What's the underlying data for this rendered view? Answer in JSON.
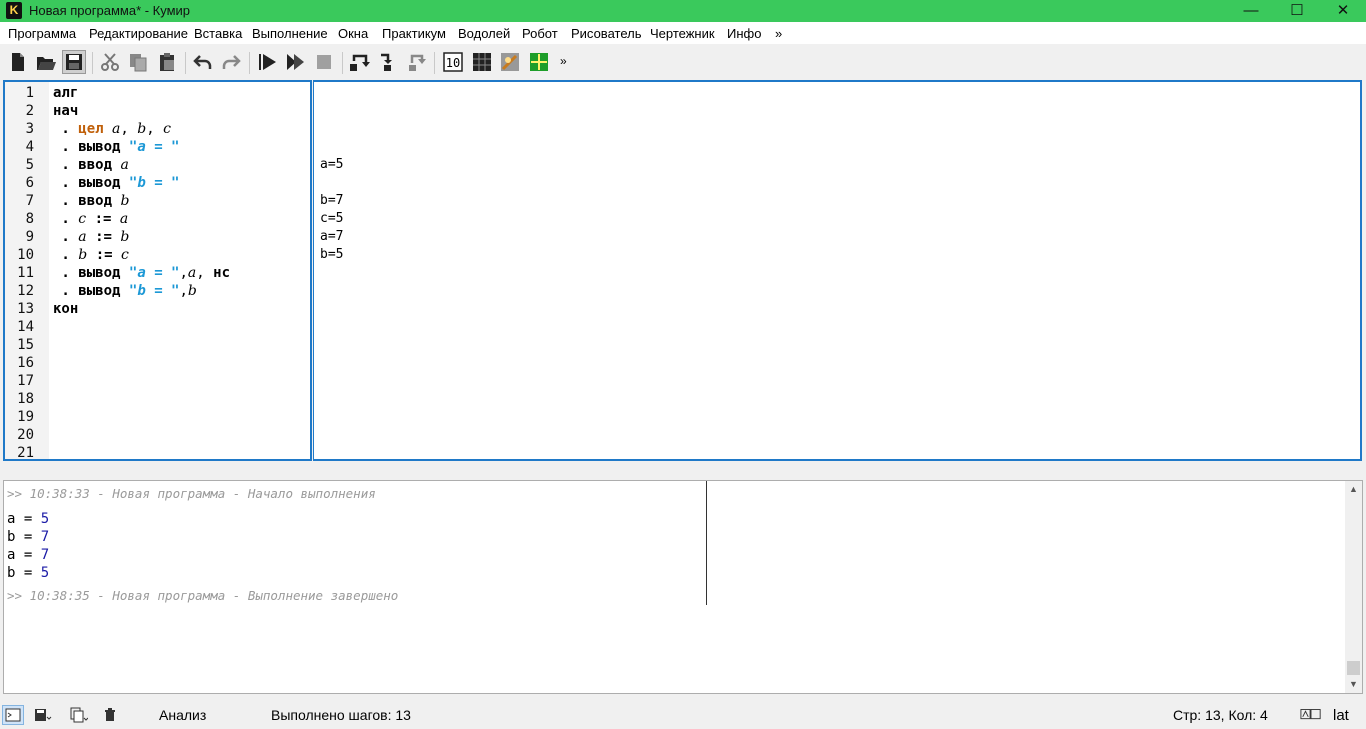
{
  "window": {
    "title": "Новая программа* - Кумир",
    "app_letter": "K",
    "minimize": "—",
    "maximize": "☐",
    "close": "✕"
  },
  "menu": [
    "Программа",
    "Редактирование",
    "Вставка",
    "Выполнение",
    "Окна",
    "Практикум",
    "Водолей",
    "Робот",
    "Рисователь",
    "Чертежник",
    "Инфо",
    "»"
  ],
  "toolbar": {
    "icons": [
      "new-file-icon",
      "open-folder-icon",
      "save-icon",
      "cut-icon",
      "copy-icon",
      "paste-icon",
      "undo-icon",
      "redo-icon",
      "run-icon",
      "run-step-icon",
      "stop-icon",
      "step-over-icon",
      "step-into-icon",
      "step-out-icon",
      "counter-icon",
      "grid-icon",
      "painter-icon",
      "drawer-icon"
    ],
    "overflow": "»"
  },
  "editor": {
    "line_numbers": [
      "1",
      "2",
      "3",
      "4",
      "5",
      "6",
      "7",
      "8",
      "9",
      "10",
      "11",
      "12",
      "13",
      "14",
      "15",
      "16",
      "17",
      "18",
      "19",
      "20",
      "21"
    ],
    "lines": [
      {
        "tokens": [
          [
            "kw",
            "алг"
          ]
        ]
      },
      {
        "tokens": [
          [
            "kw",
            "нач"
          ]
        ]
      },
      {
        "tokens": [
          [
            "dot",
            " . "
          ],
          [
            "typ",
            "цел"
          ],
          [
            "p",
            " "
          ],
          [
            "var",
            "a"
          ],
          [
            "p",
            ", "
          ],
          [
            "var",
            "b"
          ],
          [
            "p",
            ", "
          ],
          [
            "var",
            "c"
          ]
        ]
      },
      {
        "tokens": [
          [
            "dot",
            " . "
          ],
          [
            "kw",
            "вывод"
          ],
          [
            "p",
            " "
          ],
          [
            "str",
            "\""
          ],
          [
            "strv",
            "a"
          ],
          [
            "str",
            " = \""
          ]
        ]
      },
      {
        "tokens": [
          [
            "dot",
            " . "
          ],
          [
            "kw",
            "ввод"
          ],
          [
            "p",
            " "
          ],
          [
            "var",
            "a"
          ]
        ]
      },
      {
        "tokens": [
          [
            "dot",
            " . "
          ],
          [
            "kw",
            "вывод"
          ],
          [
            "p",
            " "
          ],
          [
            "str",
            "\""
          ],
          [
            "strv",
            "b"
          ],
          [
            "str",
            " = \""
          ]
        ]
      },
      {
        "tokens": [
          [
            "dot",
            " . "
          ],
          [
            "kw",
            "ввод"
          ],
          [
            "p",
            " "
          ],
          [
            "var",
            "b"
          ]
        ]
      },
      {
        "tokens": [
          [
            "dot",
            " . "
          ],
          [
            "var",
            "c"
          ],
          [
            "p",
            " "
          ],
          [
            "kw",
            ":="
          ],
          [
            "p",
            " "
          ],
          [
            "var",
            "a"
          ]
        ]
      },
      {
        "tokens": [
          [
            "dot",
            " . "
          ],
          [
            "var",
            "a"
          ],
          [
            "p",
            " "
          ],
          [
            "kw",
            ":="
          ],
          [
            "p",
            " "
          ],
          [
            "var",
            "b"
          ]
        ]
      },
      {
        "tokens": [
          [
            "dot",
            " . "
          ],
          [
            "var",
            "b"
          ],
          [
            "p",
            " "
          ],
          [
            "kw",
            ":="
          ],
          [
            "p",
            " "
          ],
          [
            "var",
            "c"
          ]
        ]
      },
      {
        "tokens": [
          [
            "dot",
            " . "
          ],
          [
            "kw",
            "вывод"
          ],
          [
            "p",
            " "
          ],
          [
            "str",
            "\""
          ],
          [
            "strv",
            "a"
          ],
          [
            "str",
            " = \""
          ],
          [
            "p",
            ","
          ],
          [
            "var",
            "a"
          ],
          [
            "p",
            ", "
          ],
          [
            "kw",
            "нс"
          ]
        ]
      },
      {
        "tokens": [
          [
            "dot",
            " . "
          ],
          [
            "kw",
            "вывод"
          ],
          [
            "p",
            " "
          ],
          [
            "str",
            "\""
          ],
          [
            "strv",
            "b"
          ],
          [
            "str",
            " = \""
          ],
          [
            "p",
            ","
          ],
          [
            "var",
            "b"
          ]
        ]
      },
      {
        "tokens": [
          [
            "kw",
            "кон"
          ]
        ]
      }
    ]
  },
  "margin": [
    {
      "line": 5,
      "text": "a=5"
    },
    {
      "line": 7,
      "text": "b=7"
    },
    {
      "line": 8,
      "text": "c=5"
    },
    {
      "line": 9,
      "text": "a=7"
    },
    {
      "line": 10,
      "text": "b=5"
    }
  ],
  "console": {
    "start": ">> 10:38:33 - Новая программа - Начало выполнения",
    "outputs": [
      {
        "label": "a = ",
        "value": "5"
      },
      {
        "label": "b = ",
        "value": "7"
      },
      {
        "label": "a = ",
        "value": "7"
      },
      {
        "label": "b = ",
        "value": "5"
      }
    ],
    "end": ">> 10:38:35 - Новая программа - Выполнение завершено"
  },
  "status": {
    "mode": "Анализ",
    "steps": "Выполнено шагов: 13",
    "position": "Стр: 13, Кол: 4",
    "layout": "lat"
  },
  "colors": {
    "titlebar": "#3ac95c",
    "panel_border": "#1f79c8",
    "keyword_type": "#c0600a",
    "string": "#1c98d6",
    "console_value": "#1a1aa6"
  }
}
